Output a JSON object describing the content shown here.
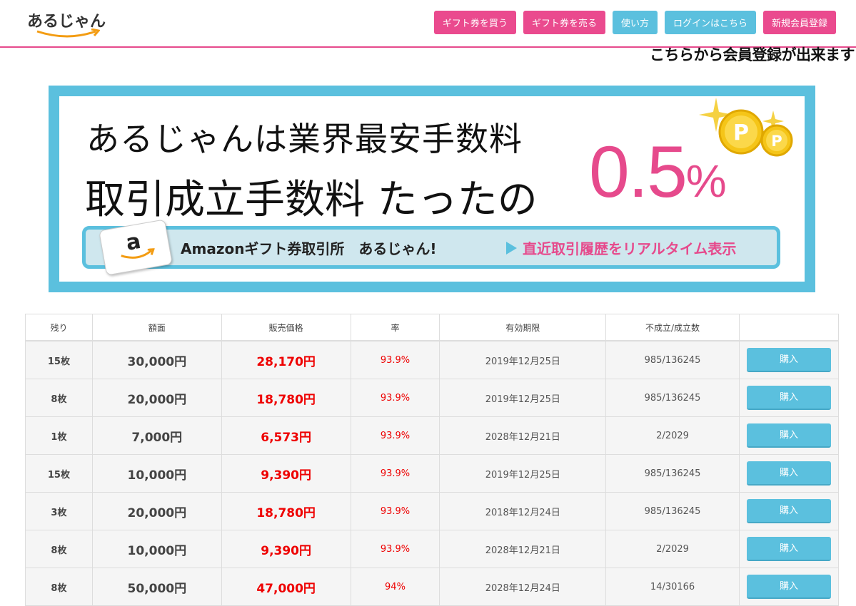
{
  "logo": {
    "text": "あるじゃん"
  },
  "nav": {
    "buy_gift": "ギフト券を買う",
    "sell_gift": "ギフト券を売る",
    "how_to": "使い方",
    "login": "ログインはこちら",
    "signup": "新規会員登録"
  },
  "signup_note": "こちらから会員登録が出来ます",
  "banner": {
    "line1": "あるじゃんは業界最安手数料",
    "line2": "取引成立手数料 たったの",
    "rate": "0.5",
    "rate_unit": "%",
    "card_letter": "a",
    "bar_text": "Amazonギフト券取引所　あるじゃん!",
    "bar_link": "直近取引履歴をリアルタイム表示",
    "coin_letter": "P"
  },
  "table": {
    "headers": [
      "残り",
      "額面",
      "販売価格",
      "率",
      "有効期限",
      "不成立/成立数",
      ""
    ],
    "rows": [
      [
        "15枚",
        "30,000円",
        "28,170円",
        "93.9%",
        "2019年12月25日",
        "985/136245",
        "購入"
      ],
      [
        "8枚",
        "20,000円",
        "18,780円",
        "93.9%",
        "2019年12月25日",
        "985/136245",
        "購入"
      ],
      [
        "1枚",
        "7,000円",
        "6,573円",
        "93.9%",
        "2028年12月21日",
        "2/2029",
        "購入"
      ],
      [
        "15枚",
        "10,000円",
        "9,390円",
        "93.9%",
        "2019年12月25日",
        "985/136245",
        "購入"
      ],
      [
        "3枚",
        "20,000円",
        "18,780円",
        "93.9%",
        "2018年12月24日",
        "985/136245",
        "購入"
      ],
      [
        "8枚",
        "10,000円",
        "9,390円",
        "93.9%",
        "2028年12月21日",
        "2/2029",
        "購入"
      ],
      [
        "8枚",
        "50,000円",
        "47,000円",
        "94%",
        "2028年12月24日",
        "14/30166",
        "購入"
      ]
    ]
  },
  "colors": {
    "pink": "#ea4a8e",
    "blue": "#5bc0de",
    "price_red": "#e00000"
  }
}
